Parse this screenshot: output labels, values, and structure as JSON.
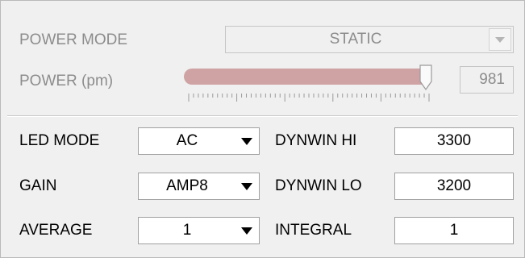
{
  "power_mode": {
    "label": "POWER MODE",
    "selected": "STATIC",
    "enabled": false
  },
  "power": {
    "label": "POWER (pm)",
    "value": "981",
    "slider_fraction": 0.98,
    "enabled": false
  },
  "led_mode": {
    "label": "LED MODE",
    "selected": "AC"
  },
  "gain": {
    "label": "GAIN",
    "selected": "AMP8"
  },
  "average": {
    "label": "AVERAGE",
    "selected": "1"
  },
  "dynwin_hi": {
    "label": "DYNWIN HI",
    "value": "3300"
  },
  "dynwin_lo": {
    "label": "DYNWIN LO",
    "value": "3200"
  },
  "integral": {
    "label": "INTEGRAL",
    "value": "1"
  },
  "colors": {
    "slider_track": "#cfa3a3",
    "disabled_text": "#8c8c8c"
  },
  "icons": {
    "dropdown_arrow": "chevron-down-icon",
    "slider_thumb": "slider-thumb-icon"
  }
}
